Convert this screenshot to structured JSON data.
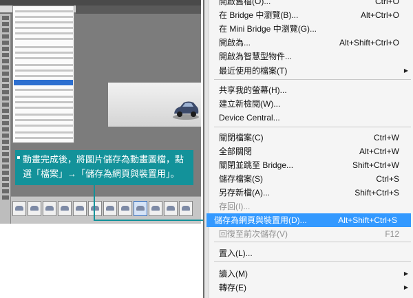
{
  "file_menu": {
    "items": [
      {
        "label": "開啟舊檔(O)...",
        "shortcut": "Ctrl+O",
        "submenu": false,
        "disabled": false,
        "highlighted": false
      },
      {
        "label": "在 Bridge 中瀏覽(B)...",
        "shortcut": "Alt+Ctrl+O",
        "submenu": false,
        "disabled": false,
        "highlighted": false
      },
      {
        "label": "在 Mini Bridge 中瀏覽(G)...",
        "shortcut": "",
        "submenu": false,
        "disabled": false,
        "highlighted": false
      },
      {
        "label": "開啟為...",
        "shortcut": "Alt+Shift+Ctrl+O",
        "submenu": false,
        "disabled": false,
        "highlighted": false
      },
      {
        "label": "開啟為智慧型物件...",
        "shortcut": "",
        "submenu": false,
        "disabled": false,
        "highlighted": false
      },
      {
        "label": "最近使用的檔案(T)",
        "shortcut": "",
        "submenu": true,
        "disabled": false,
        "highlighted": false
      },
      {
        "label": "共享我的螢幕(H)...",
        "shortcut": "",
        "submenu": false,
        "disabled": false,
        "highlighted": false
      },
      {
        "label": "建立新檢閱(W)...",
        "shortcut": "",
        "submenu": false,
        "disabled": false,
        "highlighted": false
      },
      {
        "label": "Device Central...",
        "shortcut": "",
        "submenu": false,
        "disabled": false,
        "highlighted": false
      },
      {
        "label": "關閉檔案(C)",
        "shortcut": "Ctrl+W",
        "submenu": false,
        "disabled": false,
        "highlighted": false
      },
      {
        "label": "全部關閉",
        "shortcut": "Alt+Ctrl+W",
        "submenu": false,
        "disabled": false,
        "highlighted": false
      },
      {
        "label": "關閉並跳至 Bridge...",
        "shortcut": "Shift+Ctrl+W",
        "submenu": false,
        "disabled": false,
        "highlighted": false
      },
      {
        "label": "儲存檔案(S)",
        "shortcut": "Ctrl+S",
        "submenu": false,
        "disabled": false,
        "highlighted": false
      },
      {
        "label": "另存新檔(A)...",
        "shortcut": "Shift+Ctrl+S",
        "submenu": false,
        "disabled": false,
        "highlighted": false
      },
      {
        "label": "存回(I)...",
        "shortcut": "",
        "submenu": false,
        "disabled": true,
        "highlighted": false
      },
      {
        "label": "儲存為網頁與裝置用(D)...",
        "shortcut": "Alt+Shift+Ctrl+S",
        "submenu": false,
        "disabled": false,
        "highlighted": true
      },
      {
        "label": "回復至前次儲存(V)",
        "shortcut": "F12",
        "submenu": false,
        "disabled": true,
        "highlighted": false
      },
      {
        "label": "置入(L)...",
        "shortcut": "",
        "submenu": false,
        "disabled": false,
        "highlighted": false
      },
      {
        "label": "讀入(M)",
        "shortcut": "",
        "submenu": true,
        "disabled": false,
        "highlighted": false
      },
      {
        "label": "轉存(E)",
        "shortcut": "",
        "submenu": true,
        "disabled": false,
        "highlighted": false
      }
    ],
    "submenu_arrow": "▶"
  },
  "callout": {
    "text": "動畫完成後，將圖片儲存為動畫圖檔，點選「檔案」→「儲存為網頁與裝置用」。"
  },
  "colors": {
    "highlight": "#3399ff",
    "callout": "#13929a",
    "menu_bg": "#f5f5f5"
  },
  "icons": {
    "submenu": "chevron-right-icon",
    "car": "car-icon"
  }
}
